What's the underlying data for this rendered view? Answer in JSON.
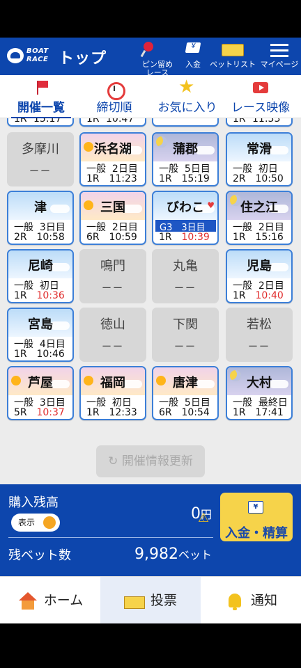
{
  "header": {
    "logo_line1": "BOAT",
    "logo_line2": "RACE",
    "title": "トップ",
    "pin_label": "ピン留め\nレース",
    "deposit_label": "入金",
    "betlist_label": "ベットリスト",
    "mypage_label": "マイページ"
  },
  "tabs": [
    {
      "label": "開催一覧",
      "icon": "flag-icon",
      "active": true
    },
    {
      "label": "締切順",
      "icon": "clock-icon"
    },
    {
      "label": "お気に入り",
      "icon": "star-icon"
    },
    {
      "label": "レース映像",
      "icon": "video-icon"
    }
  ],
  "partial_row": [
    {
      "race": "1R",
      "time": "15:17"
    },
    {
      "race": "1R",
      "time": "10:47"
    },
    {
      "race": "",
      "time": ""
    },
    {
      "race": "1R",
      "time": "11:53"
    }
  ],
  "venues": [
    {
      "name": "多摩川",
      "status": "closed",
      "dash": "ーー"
    },
    {
      "name": "浜名湖",
      "status": "open",
      "theme": "sunset",
      "grade": "一般",
      "day": "2日目",
      "race": "1R",
      "time": "11:23"
    },
    {
      "name": "蒲郡",
      "status": "open",
      "theme": "night",
      "grade": "一般",
      "day": "5日目",
      "race": "1R",
      "time": "15:19"
    },
    {
      "name": "常滑",
      "status": "open",
      "theme": "day",
      "grade": "一般",
      "day": "初日",
      "race": "2R",
      "time": "10:50"
    },
    {
      "name": "津",
      "status": "open",
      "theme": "day",
      "grade": "一般",
      "day": "3日目",
      "race": "2R",
      "time": "10:58"
    },
    {
      "name": "三国",
      "status": "open",
      "theme": "sunset",
      "grade": "一般",
      "day": "2日目",
      "race": "6R",
      "time": "10:59"
    },
    {
      "name": "びわこ",
      "status": "open",
      "theme": "day",
      "grade": "G3",
      "day": "3日目",
      "race": "1R",
      "time": "10:39",
      "highlight": true
    },
    {
      "name": "住之江",
      "status": "open",
      "theme": "night",
      "grade": "一般",
      "day": "2日目",
      "race": "1R",
      "time": "15:16"
    },
    {
      "name": "尼崎",
      "status": "open",
      "theme": "day",
      "grade": "一般",
      "day": "初日",
      "race": "1R",
      "time": "10:36",
      "time_red": true
    },
    {
      "name": "鳴門",
      "status": "closed",
      "dash": "ーー"
    },
    {
      "name": "丸亀",
      "status": "closed",
      "dash": "ーー"
    },
    {
      "name": "児島",
      "status": "open",
      "theme": "day",
      "grade": "一般",
      "day": "2日目",
      "race": "1R",
      "time": "10:40",
      "time_red": true
    },
    {
      "name": "宮島",
      "status": "open",
      "theme": "day",
      "grade": "一般",
      "day": "4日目",
      "race": "1R",
      "time": "10:46"
    },
    {
      "name": "徳山",
      "status": "closed",
      "dash": "ーー"
    },
    {
      "name": "下関",
      "status": "closed",
      "dash": "ーー"
    },
    {
      "name": "若松",
      "status": "closed",
      "dash": "ーー"
    },
    {
      "name": "芦屋",
      "status": "open",
      "theme": "sunset",
      "grade": "一般",
      "day": "3日目",
      "race": "5R",
      "time": "10:37",
      "time_red": true
    },
    {
      "name": "福岡",
      "status": "open",
      "theme": "sunset",
      "grade": "一般",
      "day": "初日",
      "race": "1R",
      "time": "12:33"
    },
    {
      "name": "唐津",
      "status": "open",
      "theme": "sunset",
      "grade": "一般",
      "day": "5日目",
      "race": "6R",
      "time": "10:54"
    },
    {
      "name": "大村",
      "status": "open",
      "theme": "night",
      "grade": "一般",
      "day": "最終日",
      "race": "1R",
      "time": "17:41"
    }
  ],
  "refresh_button": "開催情報更新",
  "balance": {
    "label": "購入残高",
    "toggle_label": "表示",
    "amount": "0",
    "amount_unit": "円",
    "bet_label": "残ベット数",
    "bet_count": "9,982",
    "bet_unit": "ベット",
    "deposit_button": "入金・精算"
  },
  "bottom_nav": [
    {
      "label": "ホーム",
      "icon": "home-icon"
    },
    {
      "label": "投票",
      "icon": "ticket-icon",
      "active": true
    },
    {
      "label": "通知",
      "icon": "bell-icon"
    }
  ]
}
